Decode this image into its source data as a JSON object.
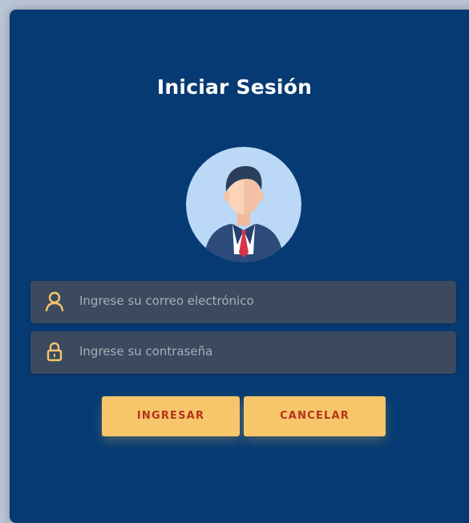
{
  "login": {
    "title": "Iniciar Sesión",
    "email_placeholder": "Ingrese su correo electrónico",
    "password_placeholder": "Ingrese su contraseña",
    "submit_label": "INGRESAR",
    "cancel_label": "CANCELAR"
  },
  "icons": {
    "email_field": "user-icon",
    "password_field": "lock-icon",
    "avatar": "businessman-avatar"
  },
  "colors": {
    "card_background": "#063a72",
    "page_background": "#b8c3d4",
    "field_background": "#3b4a5e",
    "accent": "#f7c66a",
    "button_text": "#b4331c"
  }
}
